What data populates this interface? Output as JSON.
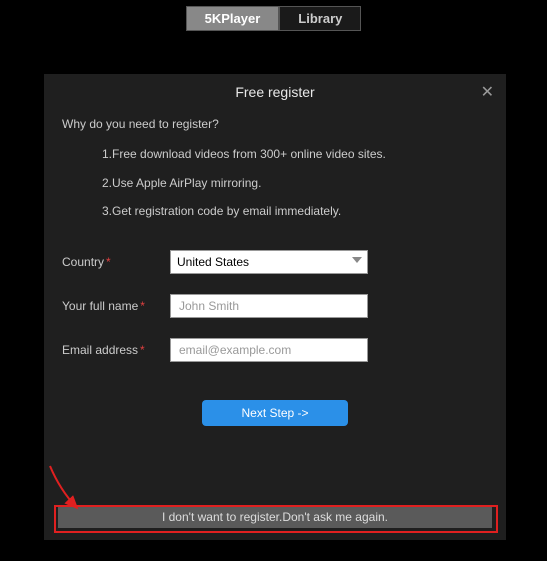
{
  "tabs": {
    "player": "5KPlayer",
    "library": "Library"
  },
  "modal": {
    "title": "Free register",
    "why": "Why do you need to register?",
    "reasons": [
      "1.Free download videos from 300+ online video sites.",
      "2.Use Apple AirPlay mirroring.",
      "3.Get registration code by email immediately."
    ],
    "labels": {
      "country": "Country",
      "name": "Your full name",
      "email": "Email address"
    },
    "country_value": "United States",
    "name_placeholder": "John Smith",
    "email_placeholder": "email@example.com",
    "next": "Next Step ->",
    "skip": "I don't want to register.Don't ask me again."
  }
}
